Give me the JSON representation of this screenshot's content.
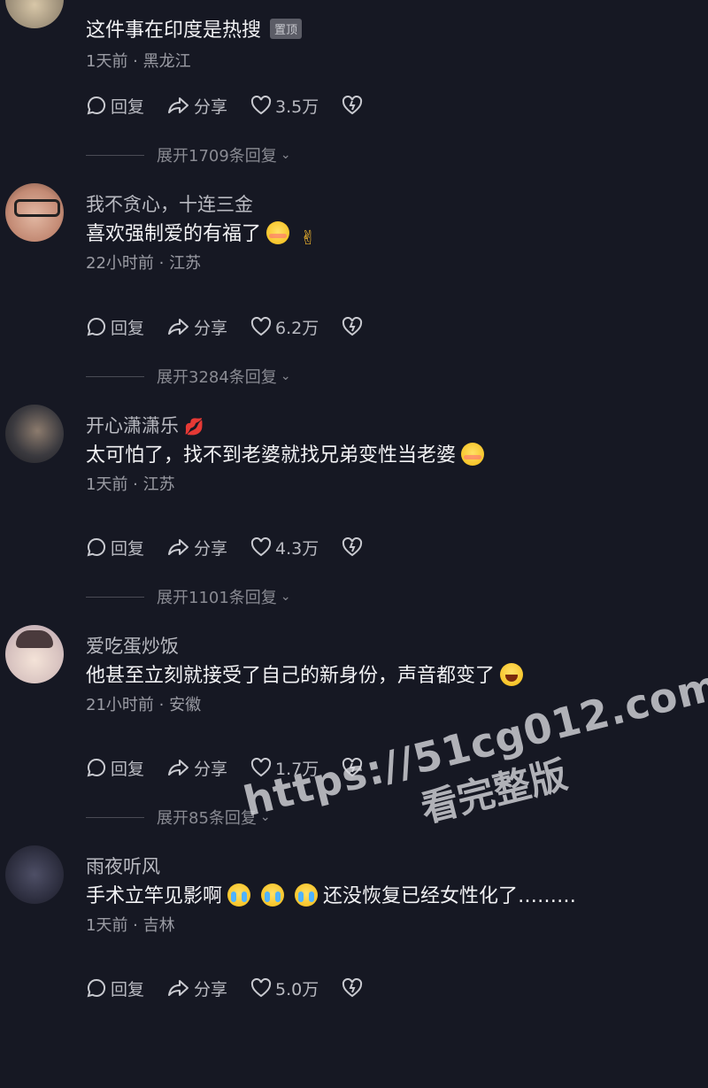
{
  "comments": [
    {
      "username": "",
      "text": "这件事在印度是热搜",
      "pinned_label": "置顶",
      "meta": "1天前 · 黑龙江",
      "reply_label": "回复",
      "share_label": "分享",
      "likes": "3.5万",
      "expand_label": "展开1709条回复"
    },
    {
      "username": "我不贪心，十连三金",
      "text": "喜欢强制爱的有福了",
      "emojis": [
        "flushed",
        "fingers-crossed-hand"
      ],
      "meta": "22小时前 · 江苏",
      "reply_label": "回复",
      "share_label": "分享",
      "likes": "6.2万",
      "expand_label": "展开3284条回复"
    },
    {
      "username": "开心潇潇乐",
      "username_emoji": "lips",
      "text": "太可怕了，找不到老婆就找兄弟变性当老婆",
      "emojis": [
        "flushed"
      ],
      "meta": "1天前 · 江苏",
      "reply_label": "回复",
      "share_label": "分享",
      "likes": "4.3万",
      "expand_label": "展开1101条回复"
    },
    {
      "username": "爱吃蛋炒饭",
      "text": "他甚至立刻就接受了自己的新身份，声音都变了",
      "emojis": [
        "laughing"
      ],
      "meta": "21小时前 · 安徽",
      "reply_label": "回复",
      "share_label": "分享",
      "likes": "1.7万",
      "expand_label": "展开85条回复"
    },
    {
      "username": "雨夜听风",
      "text_before": "手术立竿见影啊",
      "emojis": [
        "crying",
        "crying",
        "crying"
      ],
      "text_after": "还没恢复已经女性化了………",
      "meta": "1天前 · 吉林",
      "reply_label": "回复",
      "share_label": "分享",
      "likes": "5.0万"
    }
  ],
  "watermark": {
    "url": "https://51cg012.com",
    "sub": "看完整版"
  },
  "colors": {
    "background": "#161823",
    "text": "#f2f2f4",
    "secondary": "#9b9ca4",
    "accent_lips": "#e0245e"
  }
}
